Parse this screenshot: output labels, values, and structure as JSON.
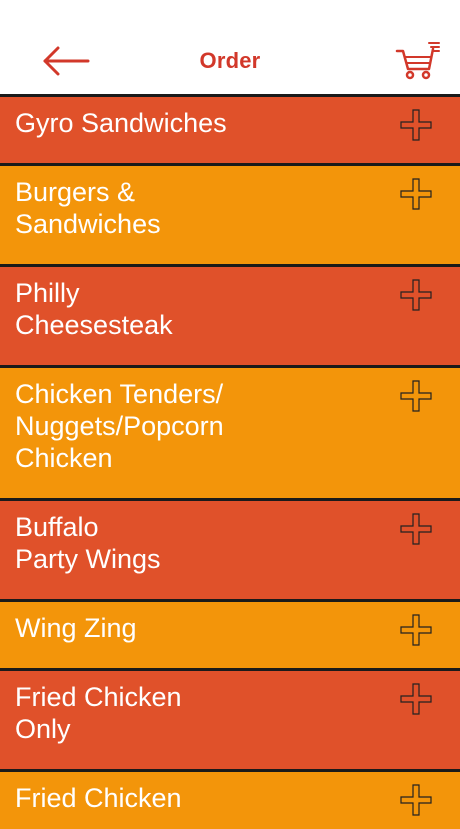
{
  "header": {
    "title": "Order",
    "back_icon": "arrow-left-icon",
    "cart_icon": "shopping-cart-icon"
  },
  "colors": {
    "accent": "#d2382a",
    "row_dark": "#e0512a",
    "row_light": "#f3950a",
    "divider": "#1a1a1a"
  },
  "menu": {
    "items": [
      {
        "label": "Gyro Sandwiches",
        "tone": "dark"
      },
      {
        "label": "Burgers &\nSandwiches",
        "tone": "light"
      },
      {
        "label": "Philly\nCheesesteak",
        "tone": "dark"
      },
      {
        "label": "Chicken Tenders/\nNuggets/Popcorn\nChicken",
        "tone": "light"
      },
      {
        "label": "Buffalo\nParty Wings",
        "tone": "dark"
      },
      {
        "label": "Wing Zing",
        "tone": "light"
      },
      {
        "label": "Fried Chicken\nOnly",
        "tone": "dark"
      },
      {
        "label": "Fried Chicken",
        "tone": "light"
      }
    ],
    "expand_icon": "plus-icon"
  }
}
